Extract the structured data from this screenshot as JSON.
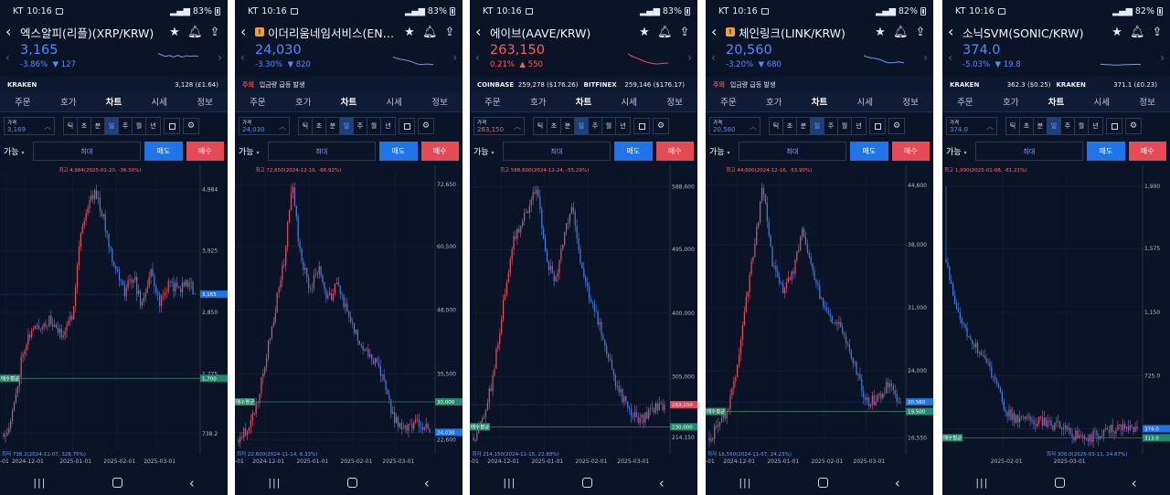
{
  "colors": {
    "up": "#e05561",
    "down": "#4a7fe0",
    "background": "#0b1426",
    "accent_blue": "#1e74e8",
    "accent_red": "#e84a55"
  },
  "tabs": [
    "주문",
    "호가",
    "차트",
    "시세",
    "정보"
  ],
  "timeframes": [
    "틱",
    "초",
    "분",
    "일",
    "주",
    "월",
    "년"
  ],
  "labels": {
    "price": "가격",
    "available": "가능",
    "max": "최대",
    "sell": "매도",
    "buy": "매수",
    "avg_buy": "매수평균"
  },
  "panels": [
    {
      "status": {
        "carrier": "KT",
        "time": "10:16",
        "battery": "83%"
      },
      "title": "엑스알피(리플)(XRP/KRW)",
      "warning": false,
      "price": "3,165",
      "change_pct": "-3.86%",
      "change_amt": "127",
      "direction": "down",
      "info": {
        "type": "exchanges",
        "items": [
          {
            "name": "KRAKEN",
            "value": "3,128 (£1.64)"
          }
        ]
      },
      "order_price": "3,169",
      "chart_data": {
        "type": "candlestick",
        "y_ticks": [
          "4,984",
          "3,925",
          "2,850",
          "1,775",
          "738.2"
        ],
        "y_tick_values": [
          4984,
          3925,
          2850,
          1775,
          738.2
        ],
        "y_range": [
          450,
          5280
        ],
        "x_ticks": [
          "-01",
          "2024-12-01",
          "2025-01-01",
          "2025-02-01",
          "2025-03-01"
        ],
        "x_tick_pos": [
          0.01,
          0.11,
          0.36,
          0.59,
          0.8
        ],
        "high_label": "최고 4,984(2025-01-20, -36.50%)",
        "high_at": 0.48,
        "low_label": "최저 738.2(2024-11-07, 328.75%)",
        "low_at": 0.0,
        "current_tag": "3,165",
        "avg_tag": "1,700",
        "avg_value": 1700,
        "keyframes": [
          [
            0,
            738
          ],
          [
            0.03,
            900
          ],
          [
            0.06,
            1300
          ],
          [
            0.1,
            2200
          ],
          [
            0.14,
            2500
          ],
          [
            0.18,
            2600
          ],
          [
            0.24,
            2700
          ],
          [
            0.3,
            2450
          ],
          [
            0.36,
            2800
          ],
          [
            0.4,
            4200
          ],
          [
            0.44,
            4700
          ],
          [
            0.48,
            4984
          ],
          [
            0.52,
            4500
          ],
          [
            0.57,
            3800
          ],
          [
            0.63,
            3200
          ],
          [
            0.68,
            3500
          ],
          [
            0.72,
            2950
          ],
          [
            0.77,
            3550
          ],
          [
            0.82,
            3000
          ],
          [
            0.86,
            3350
          ],
          [
            0.92,
            3250
          ],
          [
            0.97,
            3400
          ],
          [
            1.0,
            3165
          ]
        ],
        "seed": 11
      }
    },
    {
      "status": {
        "carrier": "KT",
        "time": "10:16",
        "battery": "83%"
      },
      "title": "이더리움네임서비스(ENS/...",
      "warning": true,
      "price": "24,030",
      "change_pct": "-3.30%",
      "change_amt": "820",
      "direction": "down",
      "info": {
        "type": "caution",
        "label": "주의",
        "text": "입금량 급등 발생"
      },
      "order_price": "24,030",
      "chart_data": {
        "type": "candlestick",
        "y_ticks": [
          "72,650",
          "60,500",
          "48,000",
          "35,500",
          "22,600"
        ],
        "y_tick_values": [
          72650,
          60500,
          48000,
          35500,
          22600
        ],
        "y_range": [
          20500,
          75000
        ],
        "x_ticks": [
          "-01",
          "2024-12-01",
          "2025-01-01",
          "2025-02-01",
          "2025-03-01"
        ],
        "x_tick_pos": [
          0.01,
          0.14,
          0.37,
          0.6,
          0.82
        ],
        "high_label": "최고 72,650(2024-12-16, -66.92%)",
        "high_at": 0.28,
        "low_label": "최저 22,600(2024-11-14, 6.33%)",
        "low_at": 0.03,
        "current_tag": "24,030",
        "avg_tag": "30,000",
        "avg_value": 30000,
        "keyframes": [
          [
            0,
            22600
          ],
          [
            0.05,
            25000
          ],
          [
            0.1,
            30000
          ],
          [
            0.15,
            40000
          ],
          [
            0.2,
            50000
          ],
          [
            0.24,
            58000
          ],
          [
            0.28,
            72650
          ],
          [
            0.32,
            60000
          ],
          [
            0.37,
            52000
          ],
          [
            0.42,
            56000
          ],
          [
            0.47,
            50000
          ],
          [
            0.52,
            53000
          ],
          [
            0.57,
            47000
          ],
          [
            0.62,
            43000
          ],
          [
            0.67,
            40000
          ],
          [
            0.71,
            38000
          ],
          [
            0.76,
            34000
          ],
          [
            0.81,
            27000
          ],
          [
            0.86,
            24500
          ],
          [
            0.9,
            25500
          ],
          [
            0.95,
            26000
          ],
          [
            1.0,
            24030
          ]
        ],
        "seed": 23
      }
    },
    {
      "status": {
        "carrier": "KT",
        "time": "10:16",
        "battery": "83%"
      },
      "title": "에이브(AAVE/KRW)",
      "warning": false,
      "price": "263,150",
      "change_pct": "0.21%",
      "change_amt": "550",
      "direction": "up",
      "info": {
        "type": "exchanges",
        "items": [
          {
            "name": "COINBASE",
            "value": "259,278 ($176.26)"
          },
          {
            "name": "BITFINEX",
            "value": "259,146 ($176.17)"
          }
        ]
      },
      "order_price": "263,150",
      "chart_data": {
        "type": "candlestick",
        "y_ticks": [
          "588,600",
          "495,000",
          "400,000",
          "305,000",
          "214,150"
        ],
        "y_tick_values": [
          588600,
          495000,
          400000,
          305000,
          214150
        ],
        "y_range": [
          195000,
          610000
        ],
        "x_ticks": [
          "-01",
          "2024-12-01",
          "2025-01-01",
          "2025-02-01",
          "2025-03-01"
        ],
        "x_tick_pos": [
          0.01,
          0.14,
          0.37,
          0.6,
          0.82
        ],
        "high_label": "최고 588,600(2024-12-24, -55.29%)",
        "high_at": 0.33,
        "low_label": "최저 214,150(2024-11-15, 22.88%)",
        "low_at": 0.04,
        "current_tag": "263,150",
        "avg_tag": "230,000",
        "avg_value": 230000,
        "keyframes": [
          [
            0,
            214150
          ],
          [
            0.05,
            240000
          ],
          [
            0.1,
            300000
          ],
          [
            0.15,
            400000
          ],
          [
            0.2,
            500000
          ],
          [
            0.26,
            540000
          ],
          [
            0.33,
            588600
          ],
          [
            0.38,
            480000
          ],
          [
            0.43,
            450000
          ],
          [
            0.48,
            520000
          ],
          [
            0.52,
            560000
          ],
          [
            0.56,
            480000
          ],
          [
            0.61,
            420000
          ],
          [
            0.66,
            380000
          ],
          [
            0.7,
            340000
          ],
          [
            0.74,
            300000
          ],
          [
            0.78,
            275000
          ],
          [
            0.83,
            250000
          ],
          [
            0.88,
            240000
          ],
          [
            0.93,
            255000
          ],
          [
            1.0,
            263150
          ]
        ],
        "seed": 37
      }
    },
    {
      "status": {
        "carrier": "KT",
        "time": "10:16",
        "battery": "82%"
      },
      "title": "체인링크(LINK/KRW)",
      "warning": true,
      "price": "20,560",
      "change_pct": "-3.20%",
      "change_amt": "680",
      "direction": "down",
      "info": {
        "type": "caution",
        "label": "주의",
        "text": "입금량 급등 발생"
      },
      "order_price": "20,560",
      "chart_data": {
        "type": "candlestick",
        "y_ticks": [
          "44,600",
          "38,000",
          "31,000",
          "24,000",
          "16,550"
        ],
        "y_tick_values": [
          44600,
          38000,
          31000,
          24000,
          16550
        ],
        "y_range": [
          15200,
          46000
        ],
        "x_ticks": [
          "-01",
          "2024-12-01",
          "2025-01-01",
          "2025-02-01",
          "2025-03-01"
        ],
        "x_tick_pos": [
          0.01,
          0.14,
          0.37,
          0.6,
          0.82
        ],
        "high_label": "최고 44,600(2024-12-16, -53.90%)",
        "high_at": 0.28,
        "low_label": "최저 16,550(2024-11-07, 24.23%)",
        "low_at": 0.0,
        "current_tag": "20,560",
        "avg_tag": "19,500",
        "avg_value": 19500,
        "keyframes": [
          [
            0,
            16550
          ],
          [
            0.05,
            18000
          ],
          [
            0.1,
            20000
          ],
          [
            0.15,
            25000
          ],
          [
            0.2,
            33000
          ],
          [
            0.25,
            40000
          ],
          [
            0.28,
            44600
          ],
          [
            0.33,
            36000
          ],
          [
            0.38,
            33000
          ],
          [
            0.44,
            35000
          ],
          [
            0.49,
            39500
          ],
          [
            0.53,
            36000
          ],
          [
            0.58,
            32000
          ],
          [
            0.63,
            30000
          ],
          [
            0.68,
            29000
          ],
          [
            0.73,
            27000
          ],
          [
            0.78,
            23000
          ],
          [
            0.83,
            20500
          ],
          [
            0.88,
            21000
          ],
          [
            0.94,
            22500
          ],
          [
            1.0,
            20560
          ]
        ],
        "seed": 41
      }
    },
    {
      "status": {
        "carrier": "KT",
        "time": "10:16",
        "battery": "82%"
      },
      "title": "소닉SVM(SONIC/KRW)",
      "warning": false,
      "price": "374.0",
      "change_pct": "-5.03%",
      "change_amt": "19.8",
      "direction": "down",
      "info": {
        "type": "exchanges",
        "items": [
          {
            "name": "KRAKEN",
            "value": "362.3 ($0.25)"
          },
          {
            "name": "KRAKEN",
            "value": "371.1 (£0.23)"
          }
        ]
      },
      "order_price": "374.0",
      "chart_data": {
        "type": "candlestick",
        "y_ticks": [
          "1,990",
          "1,575",
          "1,150",
          "725.0",
          "313.0"
        ],
        "y_tick_values": [
          1990,
          1575,
          1150,
          725,
          313
        ],
        "y_range": [
          230,
          2080
        ],
        "x_ticks": [
          "2025-02-01",
          "2025-03-01"
        ],
        "x_tick_pos": [
          0.3,
          0.63
        ],
        "high_label": "최고 1,990(2025-01-08, -81.21%)",
        "high_at": 0.0,
        "low_label": "최저 300.0(2025-03-11, 24.67%)",
        "low_at": 0.73,
        "current_tag": "374.0",
        "avg_tag": "313.0",
        "avg_value": 313,
        "keyframes": [
          [
            0,
            1500
          ],
          [
            0.04,
            1250
          ],
          [
            0.08,
            1100
          ],
          [
            0.12,
            1000
          ],
          [
            0.17,
            900
          ],
          [
            0.22,
            780
          ],
          [
            0.27,
            650
          ],
          [
            0.31,
            500
          ],
          [
            0.36,
            440
          ],
          [
            0.42,
            430
          ],
          [
            0.48,
            420
          ],
          [
            0.54,
            410
          ],
          [
            0.6,
            380
          ],
          [
            0.66,
            340
          ],
          [
            0.7,
            310
          ],
          [
            0.73,
            300
          ],
          [
            0.78,
            330
          ],
          [
            0.84,
            360
          ],
          [
            0.9,
            380
          ],
          [
            0.95,
            390
          ],
          [
            1.0,
            374
          ]
        ],
        "seed": 53
      }
    }
  ]
}
